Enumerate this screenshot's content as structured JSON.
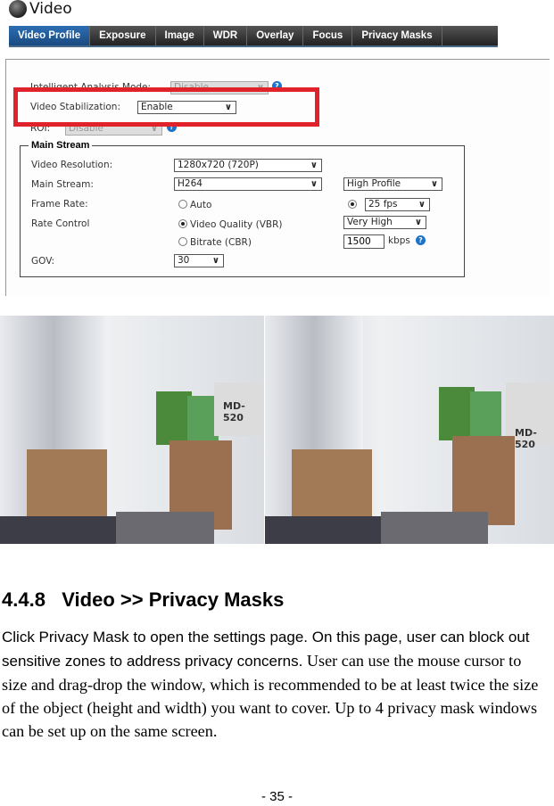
{
  "window": {
    "title": "Video"
  },
  "tabs": [
    "Video Profile",
    "Exposure",
    "Image",
    "WDR",
    "Overlay",
    "Focus",
    "Privacy Masks"
  ],
  "form": {
    "ia_mode_label": "Intelligent Analysis Mode:",
    "ia_mode_value": "Disable",
    "stab_label": "Video Stabilization:",
    "stab_value": "Enable",
    "roi_label": "ROI:",
    "roi_value": "Disable",
    "main_stream_legend": "Main Stream",
    "res_label": "Video Resolution:",
    "res_value": "1280x720 (720P)",
    "ms_label": "Main Stream:",
    "ms_value": "H264",
    "profile_value": "High Profile",
    "fr_label": "Frame Rate:",
    "fr_auto": "Auto",
    "fr_value": "25 fps",
    "rc_label": "Rate Control",
    "rc_vbr": "Video Quality (VBR)",
    "rc_quality": "Very High",
    "rc_cbr": "Bitrate (CBR)",
    "bitrate_value": "1500",
    "bitrate_unit": "kbps",
    "gov_label": "GOV:",
    "gov_value": "30",
    "help_glyph": "?"
  },
  "photos": {
    "left_label": "MD-520",
    "right_label": "MD-520"
  },
  "section": {
    "heading": "4.4.8   Video >> Privacy Masks",
    "text_sans": "Click Privacy Mask to open the settings page. On this page, user can block out sensitive zones to address privacy concerns.",
    "text_serif": " User can use the mouse cursor to size and drag-drop the window, which is recommended to be at least twice the size of the object (height and width) you want to cover. Up to 4 privacy mask windows can be set up on the same screen."
  },
  "page_number": "- 35 -",
  "colors": {
    "highlight": "#e2222a",
    "tab_active": "#2c6fb3"
  }
}
